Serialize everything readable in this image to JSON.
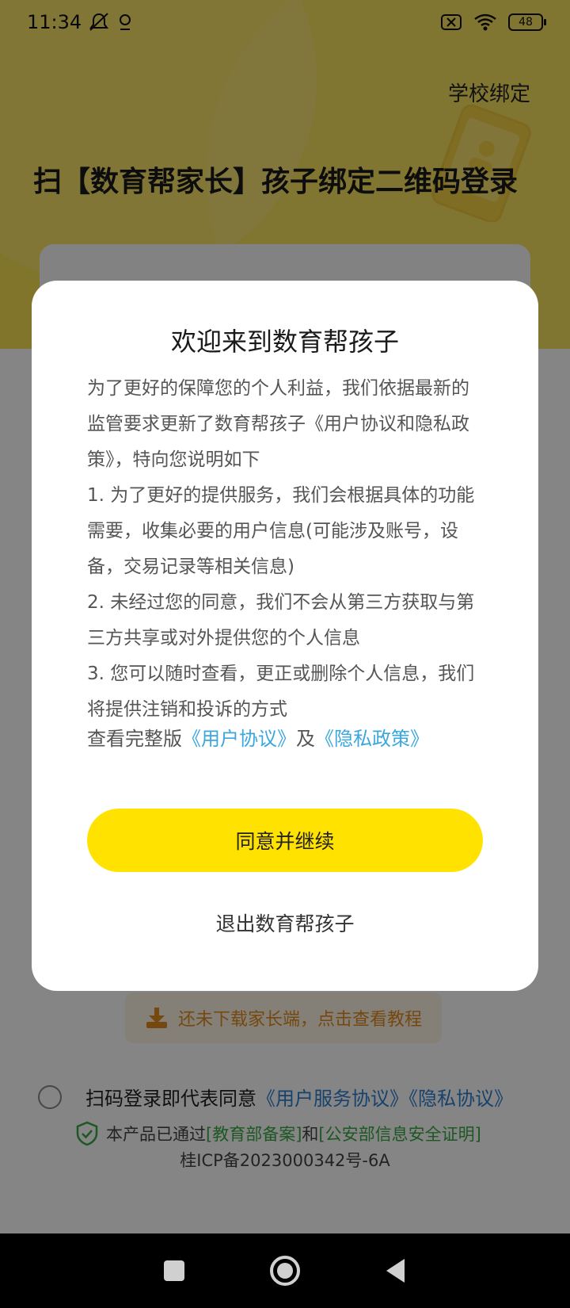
{
  "status_bar": {
    "time": "11:34",
    "battery": "48",
    "icons": [
      "mute-icon",
      "location-icon",
      "sim-x-icon",
      "wifi-icon",
      "battery-icon"
    ]
  },
  "header": {
    "school_bind": "学校绑定",
    "title": "扫【数育帮家长】孩子绑定二维码登录"
  },
  "download": {
    "text": "还未下载家长端，点击查看教程"
  },
  "agreement": {
    "prefix": "扫码登录即代表同意",
    "service_link": "《用户服务协议》",
    "privacy_link": "《隐私协议》"
  },
  "certification": {
    "prefix": "本产品已通过",
    "edu_link": "[教育部备案]",
    "middle": "和",
    "security_link": "[公安部信息安全证明]",
    "icp": "桂ICP备2023000342号-6A"
  },
  "modal": {
    "title": "欢迎来到数育帮孩子",
    "paragraphs": [
      "为了更好的保障您的个人利益，我们依据最新的监管要求更新了数育帮孩子《用户协议和隐私政策》，特向您说明如下",
      "1. 为了更好的提供服务，我们会根据具体的功能需要，收集必要的用户信息(可能涉及账号，设备，交易记录等相关信息)",
      "2. 未经过您的同意，我们不会从第三方获取与第三方共享或对外提供您的个人信息",
      "3. 您可以随时查看，更正或删除个人信息，我们将提供注销和投诉的方式"
    ],
    "links_prefix": "查看完整版",
    "user_agreement_link": "《用户协议》",
    "links_middle": "及",
    "privacy_policy_link": "《隐私政策》",
    "agree_button": "同意并继续",
    "exit_button": "退出数育帮孩子"
  },
  "colors": {
    "hero_yellow": "#f7de54",
    "button_yellow": "#ffe200",
    "link_cyan": "#3aa7df",
    "link_blue": "#2f7fd0",
    "link_green": "#39a845",
    "download_orange": "#e08a1e"
  }
}
